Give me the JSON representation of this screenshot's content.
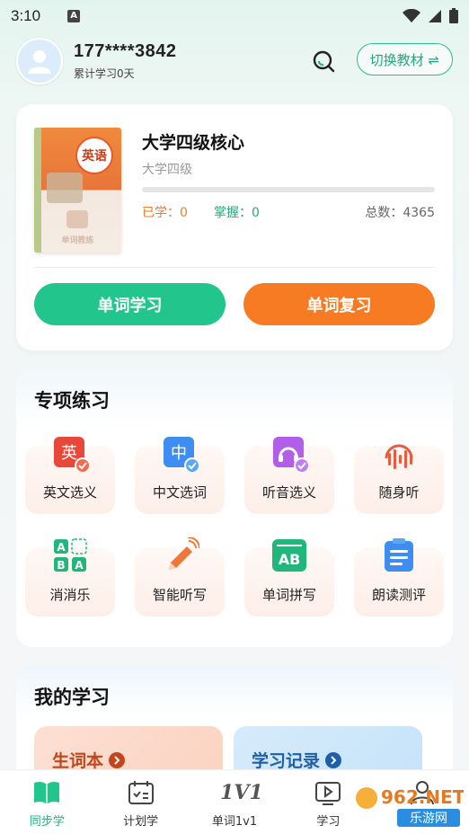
{
  "status_bar": {
    "time": "3:10",
    "notification_badge": "A"
  },
  "header": {
    "phone": "177****3842",
    "subtitle": "累计学习0天",
    "switch_label": "切换教材 ⇌"
  },
  "book": {
    "title": "大学四级核心",
    "level": "大学四级",
    "cover_badge": "英语",
    "cover_caption": "单词教练",
    "progress_fraction": 0,
    "learned": "已学：0",
    "mastered": "掌握：0",
    "total": "总数：4365",
    "learn_button": "单词学习",
    "review_button": "单词复习"
  },
  "practice": {
    "title": "专项练习",
    "items": [
      {
        "label": "英文选义",
        "icon": "english-choice-icon"
      },
      {
        "label": "中文选词",
        "icon": "chinese-choice-icon"
      },
      {
        "label": "听音选义",
        "icon": "headphone-choice-icon"
      },
      {
        "label": "随身听",
        "icon": "audio-wave-icon"
      },
      {
        "label": "消消乐",
        "icon": "match-game-icon"
      },
      {
        "label": "智能听写",
        "icon": "pencil-dictation-icon"
      },
      {
        "label": "单词拼写",
        "icon": "spelling-ab-icon"
      },
      {
        "label": "朗读测评",
        "icon": "reading-clipboard-icon"
      }
    ]
  },
  "study": {
    "title": "我的学习",
    "new_words": "生词本",
    "records": "学习记录"
  },
  "tabbar": {
    "items": [
      {
        "label": "同步学",
        "icon": "book-open-icon",
        "active": true
      },
      {
        "label": "计划学",
        "icon": "calendar-check-icon",
        "active": false
      },
      {
        "label": "单词1v1",
        "icon": "one-v-one-icon",
        "active": false
      },
      {
        "label": "学习",
        "icon": "play-screen-icon",
        "active": false
      },
      {
        "label": "",
        "icon": "user-icon",
        "active": false
      }
    ],
    "one_v_one_glyph": "1V1"
  },
  "watermark": {
    "text_top": "962.NET",
    "text_bottom": "乐游网"
  },
  "colors": {
    "accent_green": "#22c58b",
    "accent_orange": "#f77b22",
    "learned_color": "#f07a2a",
    "mastered_color": "#22a97a"
  }
}
